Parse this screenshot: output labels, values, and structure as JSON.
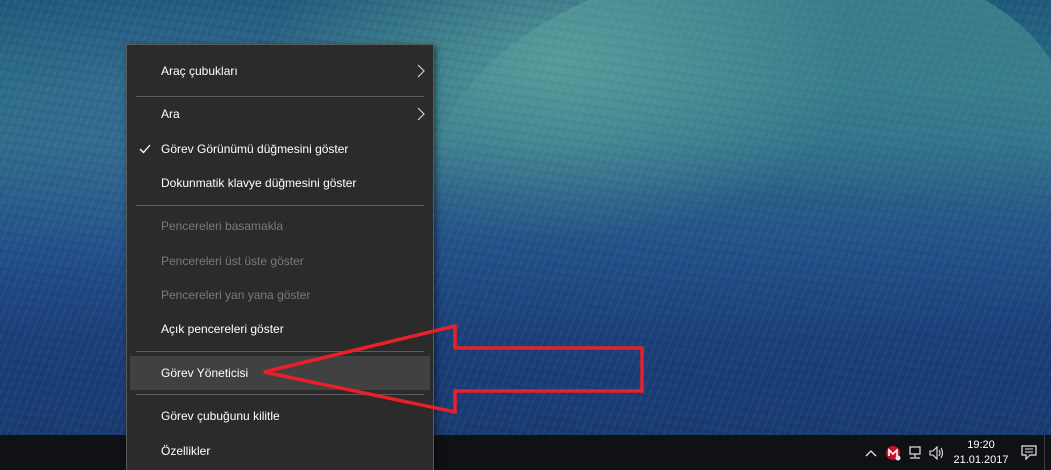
{
  "context_menu": {
    "items": [
      {
        "label": "Araç çubukları",
        "submenu": true,
        "checked": false,
        "enabled": true
      },
      {
        "label": "Ara",
        "submenu": true,
        "checked": false,
        "enabled": true
      },
      {
        "label": "Görev Görünümü düğmesini göster",
        "submenu": false,
        "checked": true,
        "enabled": true
      },
      {
        "label": "Dokunmatik klavye düğmesini göster",
        "submenu": false,
        "checked": false,
        "enabled": true
      },
      {
        "label": "Pencereleri basamakla",
        "submenu": false,
        "checked": false,
        "enabled": false
      },
      {
        "label": "Pencereleri üst üste göster",
        "submenu": false,
        "checked": false,
        "enabled": false
      },
      {
        "label": "Pencereleri yan yana göster",
        "submenu": false,
        "checked": false,
        "enabled": false
      },
      {
        "label": "Açık pencereleri göster",
        "submenu": false,
        "checked": false,
        "enabled": true
      },
      {
        "label": "Görev Yöneticisi",
        "submenu": false,
        "checked": false,
        "enabled": true,
        "highlighted": true
      },
      {
        "label": "Görev çubuğunu kilitle",
        "submenu": false,
        "checked": false,
        "enabled": true
      },
      {
        "label": "Özellikler",
        "submenu": false,
        "checked": false,
        "enabled": true
      }
    ]
  },
  "taskbar": {
    "clock": {
      "time": "19:20",
      "date": "21.01.2017"
    },
    "tray_icons": [
      "chevron-up-icon",
      "mcafee-icon",
      "network-icon",
      "volume-icon",
      "notification-icon"
    ]
  },
  "colors": {
    "menu_bg": "#2b2b2b",
    "highlight_bg": "#414141",
    "annotation_red": "#e8202a",
    "taskbar_bg": "#0f1114"
  }
}
